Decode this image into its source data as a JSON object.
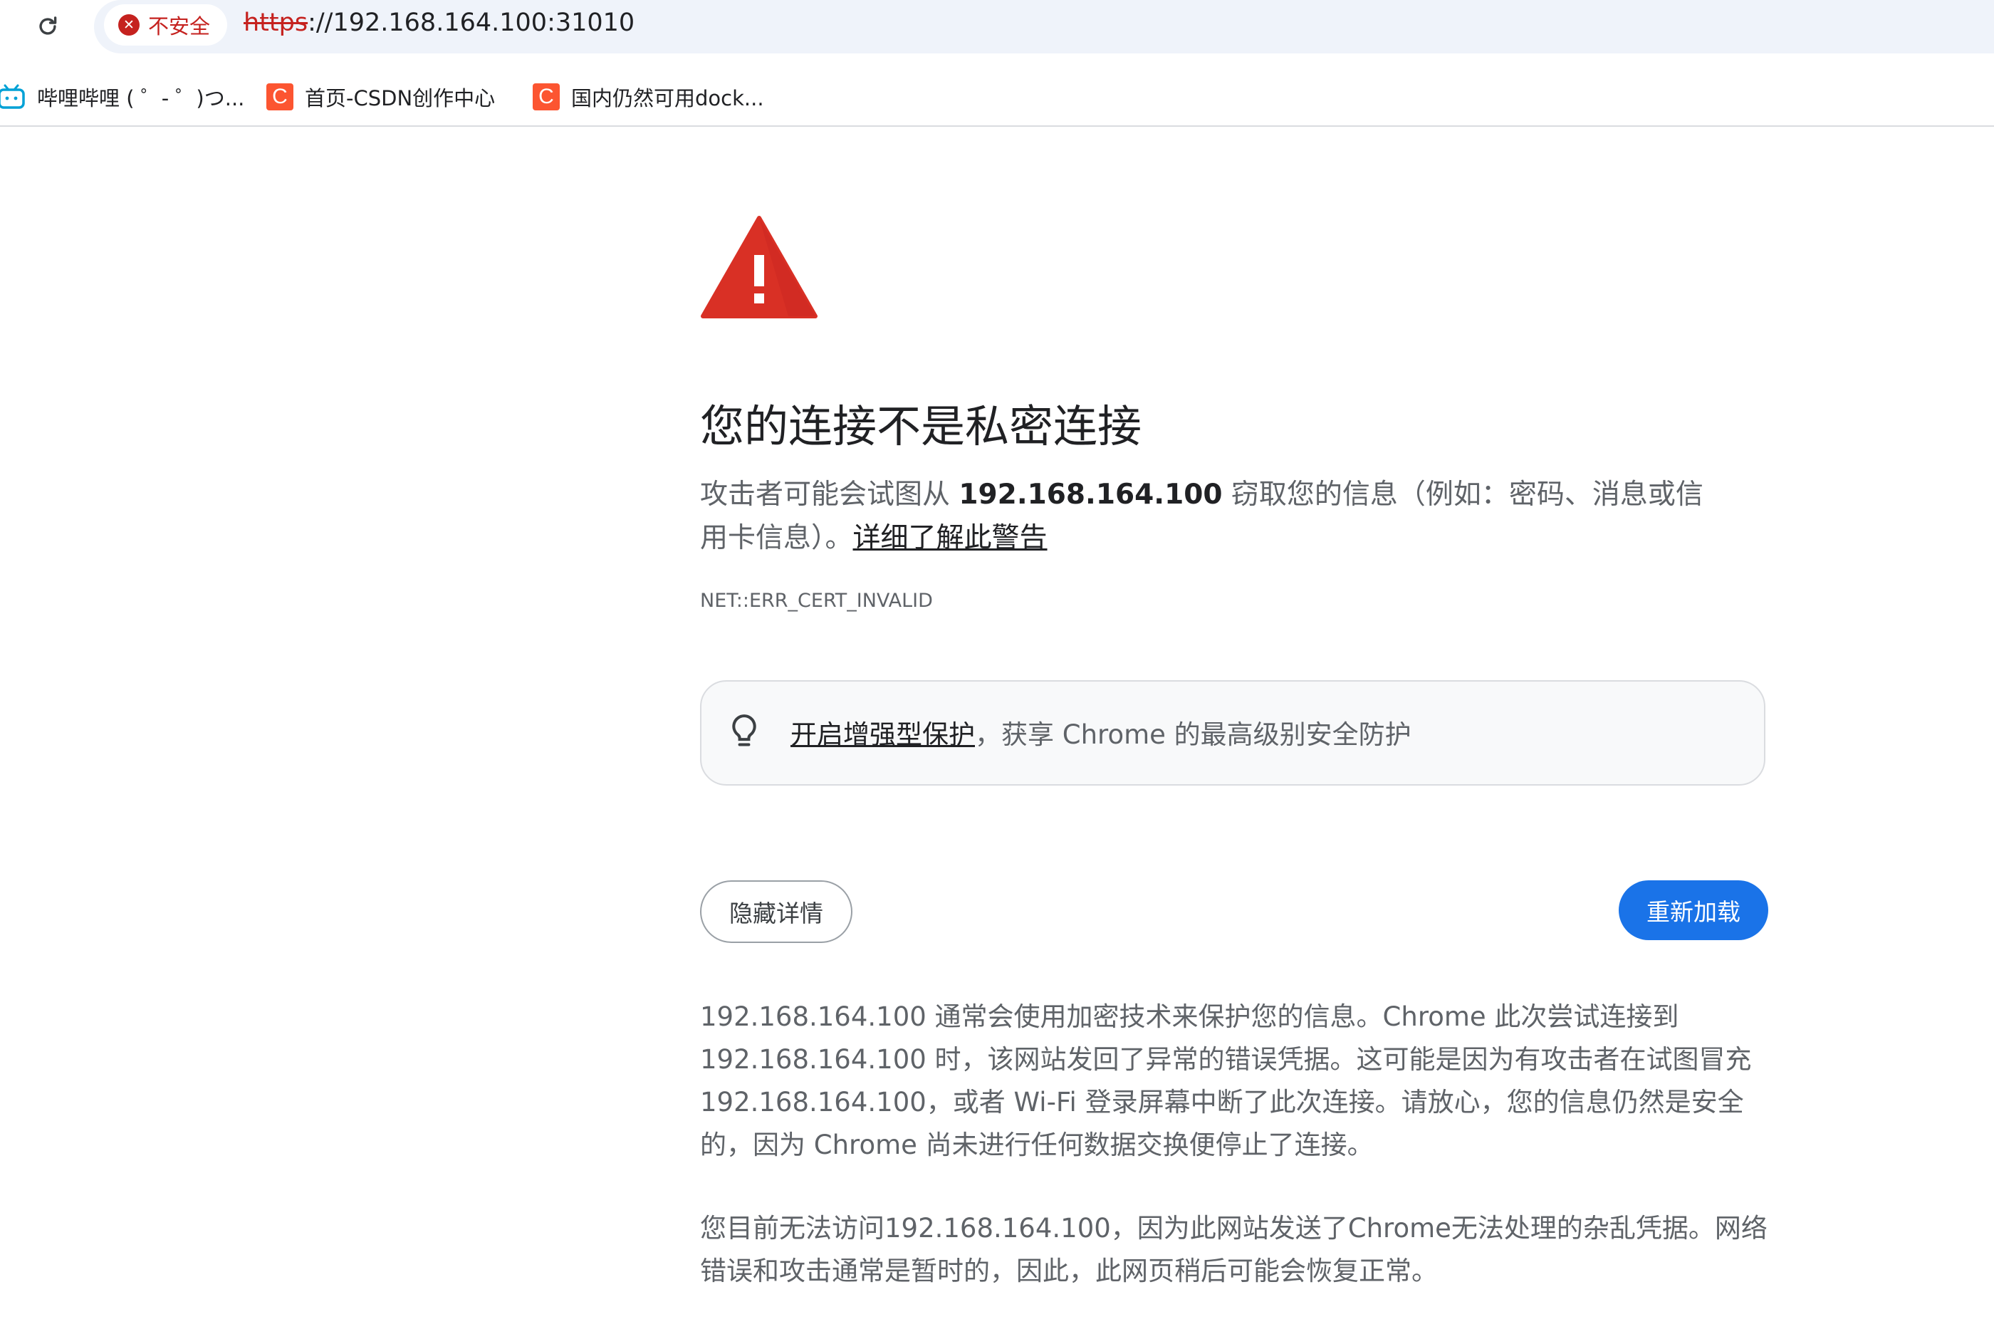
{
  "omnibox": {
    "security_label": "不安全",
    "url_scheme": "https",
    "url_rest": "://192.168.164.100:31010"
  },
  "bookmarks": [
    {
      "label": "哔哩哔哩 ( ゜- ゜)つ...",
      "icon": "bilibili-icon"
    },
    {
      "label": "首页-CSDN创作中心",
      "icon": "csdn-icon",
      "icon_glyph": "C"
    },
    {
      "label": "国内仍然可用dock...",
      "icon": "csdn-icon",
      "icon_glyph": "C"
    }
  ],
  "interstitial": {
    "title": "您的连接不是私密连接",
    "desc_prefix": "攻击者可能会试图从 ",
    "desc_host": "192.168.164.100",
    "desc_suffix": " 窃取您的信息（例如：密码、消息或信用卡信息）。",
    "learn_more": "详细了解此警告",
    "error_code": "NET::ERR_CERT_INVALID",
    "enhanced_link": "开启增强型保护",
    "enhanced_rest": "，获享 Chrome 的最高级别安全防护",
    "hide_details": "隐藏详情",
    "reload": "重新加载",
    "details_1": "192.168.164.100 通常会使用加密技术来保护您的信息。Chrome 此次尝试连接到 192.168.164.100 时，该网站发回了异常的错误凭据。这可能是因为有攻击者在试图冒充 192.168.164.100，或者 Wi-Fi 登录屏幕中断了此次连接。请放心，您的信息仍然是安全的，因为 Chrome 尚未进行任何数据交换便停止了连接。",
    "details_2": "您目前无法访问192.168.164.100，因为此网站发送了Chrome无法处理的杂乱凭据。网络错误和攻击通常是暂时的，因此，此网页稍后可能会恢复正常。"
  },
  "colors": {
    "danger": "#c5221f",
    "warning_red": "#d93025",
    "primary_button": "#1a73e8",
    "csdn_brand": "#fc5531",
    "bilibili_brand": "#00a1d6"
  }
}
